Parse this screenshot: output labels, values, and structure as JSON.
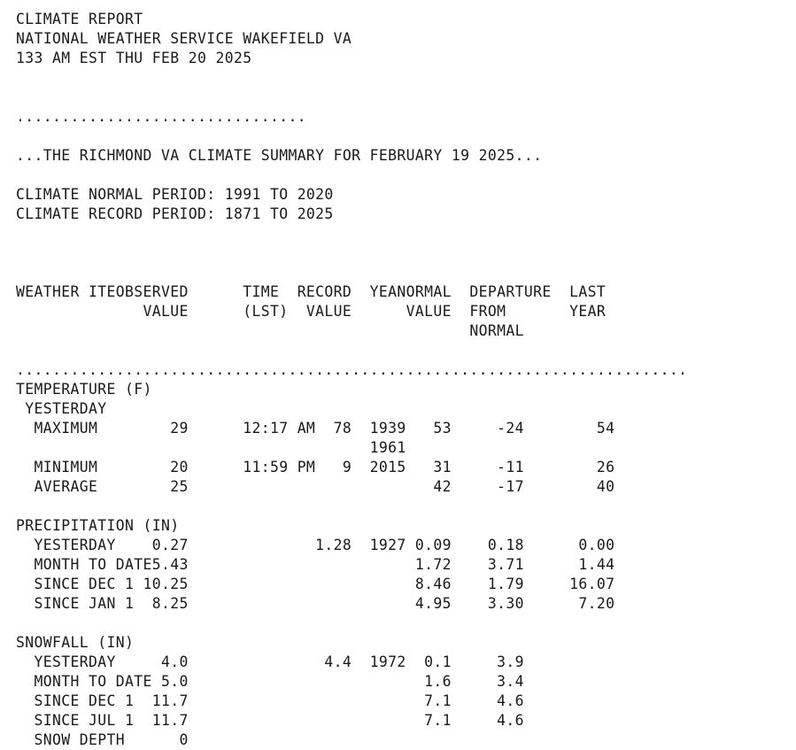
{
  "document": {
    "type": "nws-climate-report",
    "monospace_columns": 74,
    "header": {
      "title": "CLIMATE REPORT",
      "office": "NATIONAL WEATHER SERVICE WAKEFIELD VA",
      "issued": "133 AM EST THU FEB 20 2025"
    },
    "separator_short": "................................",
    "separator_long": "..........................................................................",
    "summary_line": "...THE RICHMOND VA CLIMATE SUMMARY FOR FEBRUARY 19 2025...",
    "periods": {
      "normal": "CLIMATE NORMAL PERIOD: 1991 TO 2020",
      "record": "CLIMATE RECORD PERIOD: 1871 TO 2025"
    },
    "table_header": {
      "row1": [
        "WEATHER ITEM",
        "OBSERVED",
        "TIME",
        "RECORD",
        "YEAR",
        "NORMAL",
        "DEPARTURE",
        "LAST"
      ],
      "row2": [
        "",
        "VALUE",
        "(LST)",
        "VALUE",
        "",
        "VALUE",
        "FROM",
        "YEAR"
      ],
      "row3": [
        "",
        "",
        "",
        "",
        "",
        "",
        "NORMAL",
        ""
      ]
    },
    "sections": [
      {
        "name": "TEMPERATURE (F)",
        "subheading": "YESTERDAY",
        "rows": [
          {
            "item": "MAXIMUM",
            "observed": "29",
            "time": "12:17 AM",
            "record": "78",
            "year": "1939",
            "normal": "53",
            "departure": "-24",
            "last_year": "54",
            "extra_year": "1961"
          },
          {
            "item": "MINIMUM",
            "observed": "20",
            "time": "11:59 PM",
            "record": "9",
            "year": "2015",
            "normal": "31",
            "departure": "-11",
            "last_year": "26",
            "extra_year": ""
          },
          {
            "item": "AVERAGE",
            "observed": "25",
            "time": "",
            "record": "",
            "year": "",
            "normal": "42",
            "departure": "-17",
            "last_year": "40",
            "extra_year": ""
          }
        ]
      },
      {
        "name": "PRECIPITATION (IN)",
        "subheading": "",
        "rows": [
          {
            "item": "YESTERDAY",
            "observed": "0.27",
            "time": "",
            "record": "1.28",
            "year": "1927",
            "normal": "0.09",
            "departure": "0.18",
            "last_year": "0.00",
            "extra_year": ""
          },
          {
            "item": "MONTH TO DATE",
            "observed": "5.43",
            "time": "",
            "record": "",
            "year": "",
            "normal": "1.72",
            "departure": "3.71",
            "last_year": "1.44",
            "extra_year": ""
          },
          {
            "item": "SINCE DEC 1",
            "observed": "10.25",
            "time": "",
            "record": "",
            "year": "",
            "normal": "8.46",
            "departure": "1.79",
            "last_year": "16.07",
            "extra_year": ""
          },
          {
            "item": "SINCE JAN 1",
            "observed": "8.25",
            "time": "",
            "record": "",
            "year": "",
            "normal": "4.95",
            "departure": "3.30",
            "last_year": "7.20",
            "extra_year": ""
          }
        ]
      },
      {
        "name": "SNOWFALL (IN)",
        "subheading": "",
        "rows": [
          {
            "item": "YESTERDAY",
            "observed": "4.0",
            "time": "",
            "record": "4.4",
            "year": "1972",
            "normal": "0.1",
            "departure": "3.9",
            "last_year": "",
            "extra_year": ""
          },
          {
            "item": "MONTH TO DATE",
            "observed": "5.0",
            "time": "",
            "record": "",
            "year": "",
            "normal": "1.6",
            "departure": "3.4",
            "last_year": "",
            "extra_year": ""
          },
          {
            "item": "SINCE DEC 1",
            "observed": "11.7",
            "time": "",
            "record": "",
            "year": "",
            "normal": "7.1",
            "departure": "4.6",
            "last_year": "",
            "extra_year": ""
          },
          {
            "item": "SINCE JUL 1",
            "observed": "11.7",
            "time": "",
            "record": "",
            "year": "",
            "normal": "7.1",
            "departure": "4.6",
            "last_year": "",
            "extra_year": ""
          },
          {
            "item": "SNOW DEPTH",
            "observed": "0",
            "time": "",
            "record": "",
            "year": "",
            "normal": "",
            "departure": "",
            "last_year": "",
            "extra_year": ""
          }
        ]
      }
    ]
  }
}
